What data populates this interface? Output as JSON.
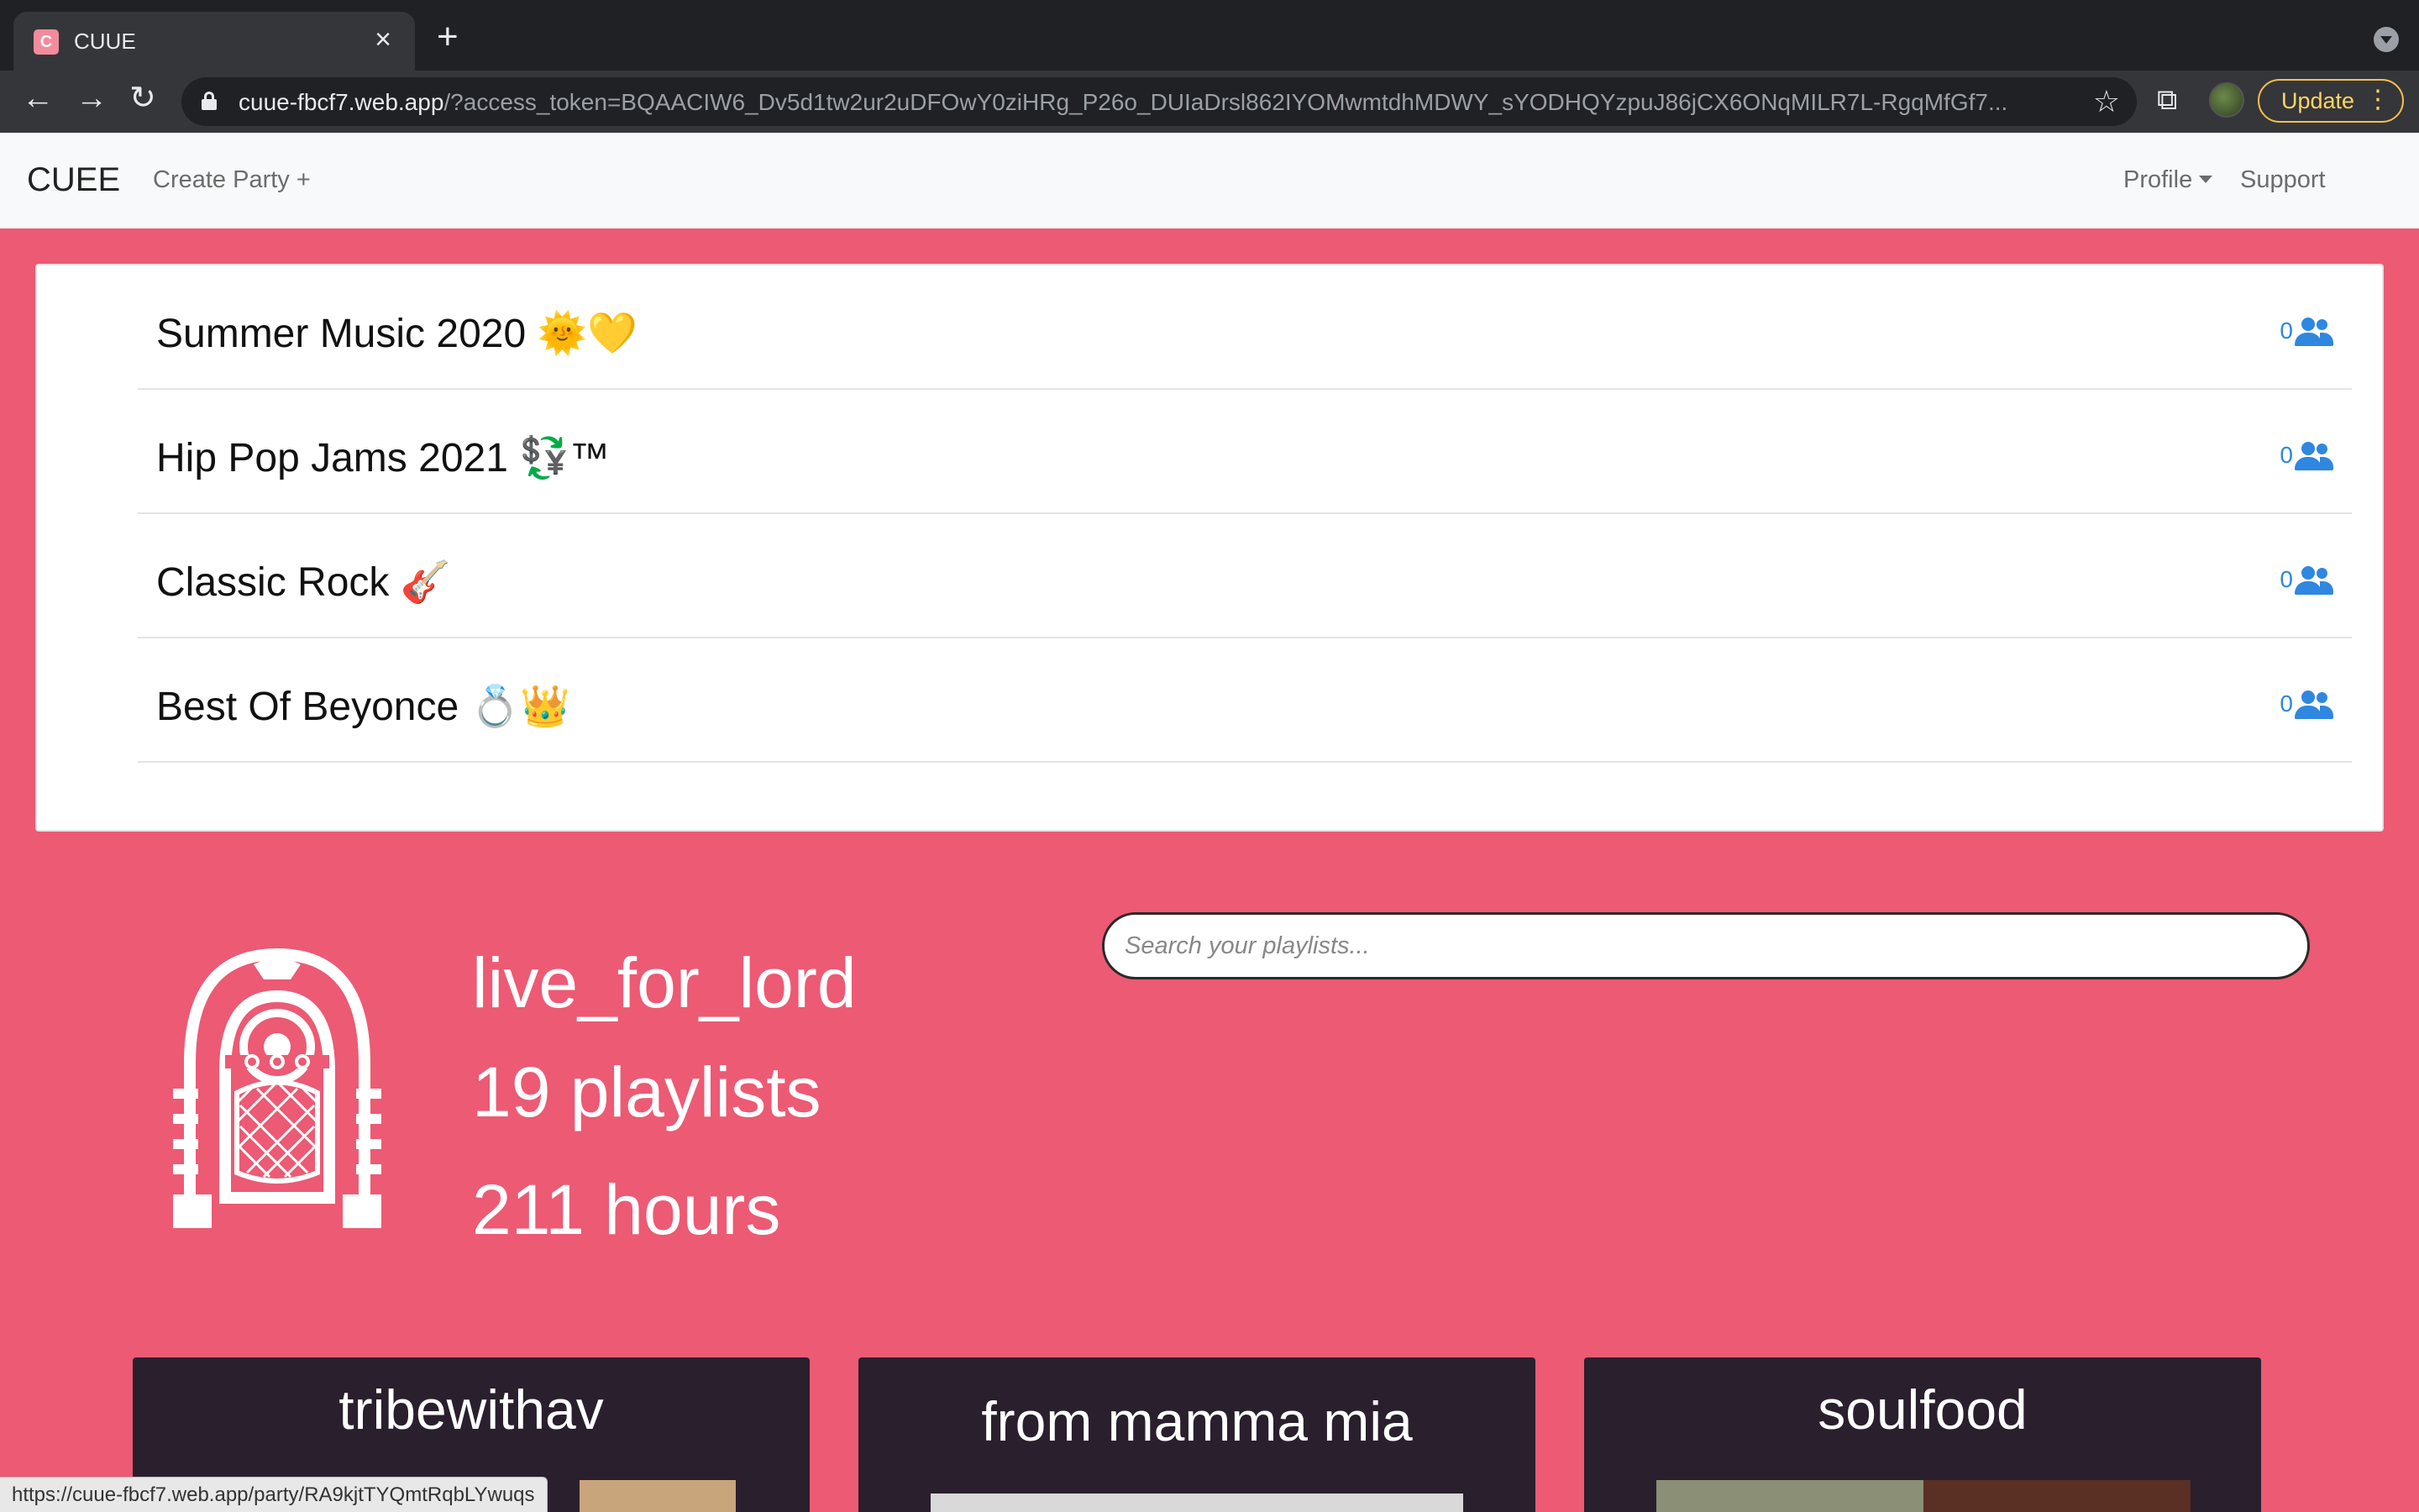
{
  "browser": {
    "tab_title": "CUUE",
    "tab_favicon_letter": "C",
    "url_host": "cuue-fbcf7.web.app",
    "url_rest": "/?access_token=BQAACIW6_Dv5d1tw2ur2uDFOwY0ziHRg_P26o_DUIaDrsl862IYOMwmtdhMDWY_sYODHQYzpuJ86jCX6ONqMILR7L-RgqMfGf7...",
    "update_label": "Update",
    "status_url": "https://cuue-fbcf7.web.app/party/RA9kjtTYQmtRqbLYwuqs"
  },
  "navbar": {
    "brand": "CUEE",
    "create_party": "Create Party +",
    "profile": "Profile",
    "support": "Support"
  },
  "parties": [
    {
      "name": "Summer Music 2020 🌞💛",
      "count": "0"
    },
    {
      "name": "Hip Pop Jams 2021 💱™",
      "count": "0"
    },
    {
      "name": "Classic Rock 🎸",
      "count": "0"
    },
    {
      "name": "Best Of Beyonce 💍👑",
      "count": "0"
    }
  ],
  "profile": {
    "username": "live_for_lord",
    "playlists": "19 playlists",
    "hours": "211 hours"
  },
  "search": {
    "placeholder": "Search your playlists..."
  },
  "playlist_cards": [
    {
      "title": "tribewithav"
    },
    {
      "title": "from mamma mia"
    },
    {
      "title": "soulfood"
    }
  ],
  "colors": {
    "background": "#ec5a74",
    "count_blue": "#2f87e0",
    "card_dark": "#2a1f2d"
  }
}
